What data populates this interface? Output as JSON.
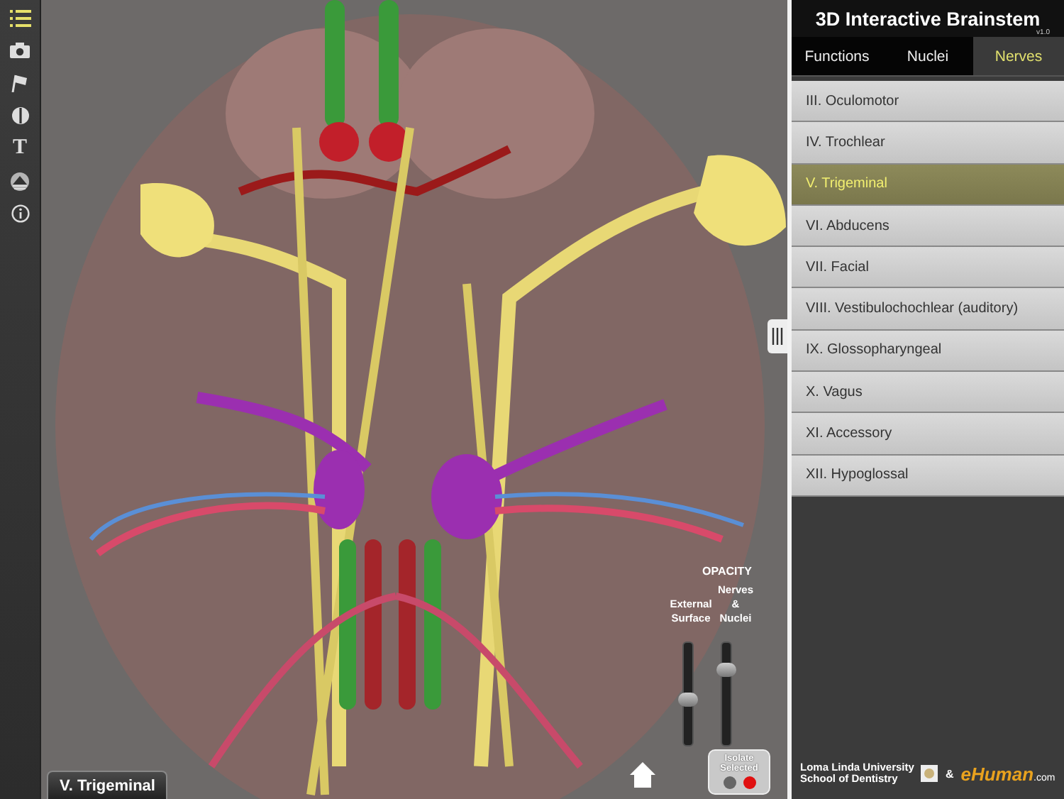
{
  "toolbar": [
    {
      "kind": "list",
      "selected": true
    },
    {
      "kind": "camera",
      "selected": false
    },
    {
      "kind": "flag",
      "selected": false
    },
    {
      "kind": "contrast",
      "selected": false
    },
    {
      "kind": "text",
      "glyph": "T",
      "selected": false
    },
    {
      "kind": "layers",
      "selected": false
    },
    {
      "kind": "info",
      "selected": false
    }
  ],
  "viewport": {
    "selected_label": "V. Trigeminal",
    "opacity": {
      "title": "OPACITY",
      "sliders": [
        {
          "label": "External Surface",
          "level": 0.43
        },
        {
          "label": "Nerves & Nuclei",
          "level": 0.77
        }
      ]
    },
    "isolate": {
      "label": "Isolate Selected",
      "on": true
    }
  },
  "panel": {
    "title": "3D Interactive Brainstem",
    "version": "v1.0",
    "tabs": [
      {
        "label": "Functions",
        "selected": false
      },
      {
        "label": "Nuclei",
        "selected": false
      },
      {
        "label": "Nerves",
        "selected": true
      }
    ],
    "items": [
      {
        "label": "III. Oculomotor",
        "selected": false
      },
      {
        "label": "IV. Trochlear",
        "selected": false
      },
      {
        "label": "V. Trigeminal",
        "selected": true
      },
      {
        "label": "VI. Abducens",
        "selected": false
      },
      {
        "label": "VII. Facial",
        "selected": false
      },
      {
        "label": "VIII. Vestibulochochlear (auditory)",
        "selected": false
      },
      {
        "label": "IX. Glossopharyngeal",
        "selected": false
      },
      {
        "label": "X. Vagus",
        "selected": false
      },
      {
        "label": "XI. Accessory",
        "selected": false
      },
      {
        "label": "XII. Hypoglossal",
        "selected": false
      }
    ],
    "footer": {
      "institution": [
        "Loma Linda University",
        "School of Dentistry"
      ],
      "ampersand": "&",
      "brand": "eHuman",
      "brand_suffix": ".com"
    }
  }
}
